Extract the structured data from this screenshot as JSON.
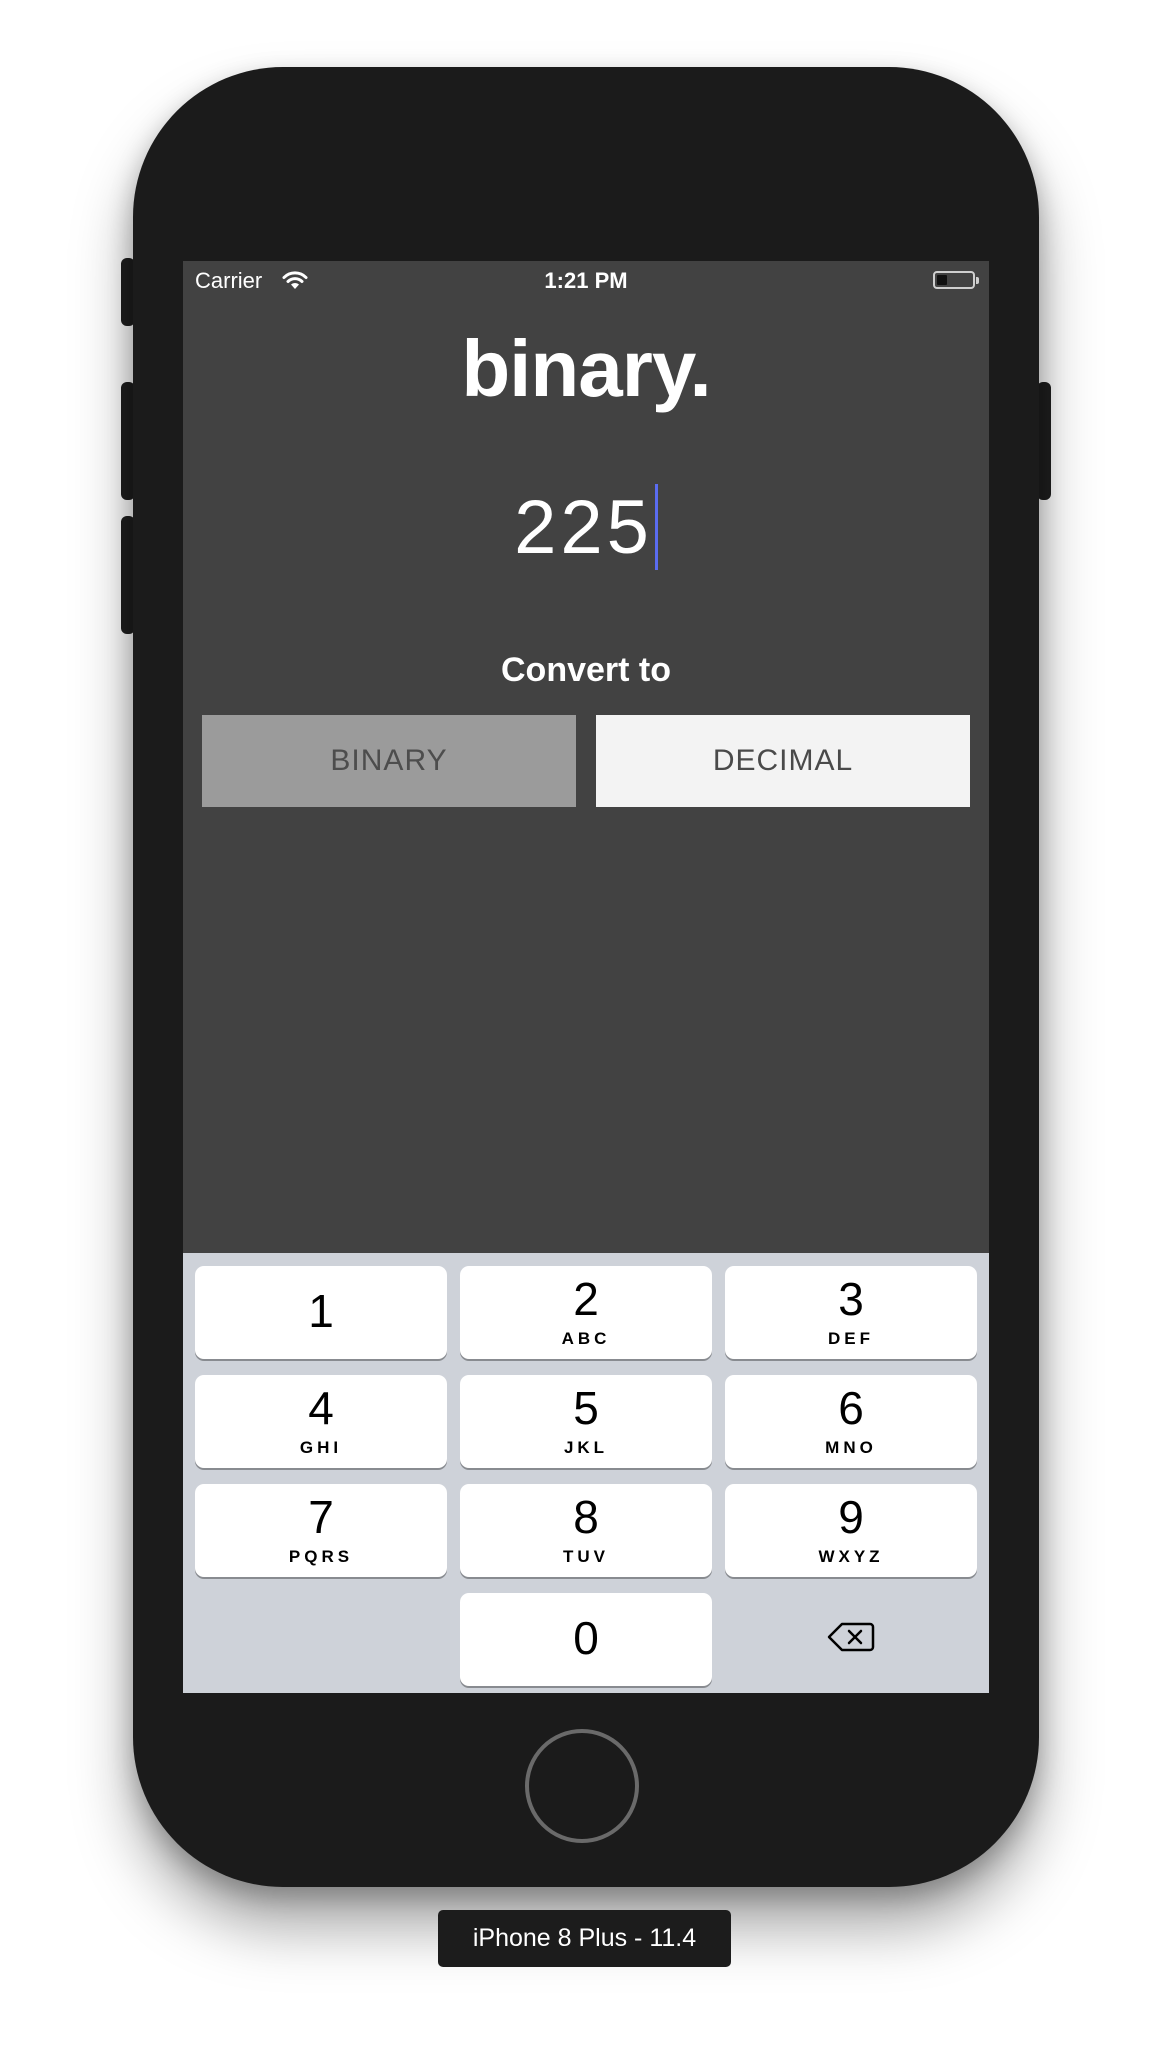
{
  "status_bar": {
    "carrier": "Carrier",
    "time": "1:21 PM"
  },
  "app": {
    "title": "binary.",
    "input_value": "225",
    "convert_label": "Convert to",
    "buttons": {
      "binary": "BINARY",
      "decimal": "DECIMAL"
    }
  },
  "keypad": {
    "keys": [
      {
        "digit": "1",
        "letters": ""
      },
      {
        "digit": "2",
        "letters": "ABC"
      },
      {
        "digit": "3",
        "letters": "DEF"
      },
      {
        "digit": "4",
        "letters": "GHI"
      },
      {
        "digit": "5",
        "letters": "JKL"
      },
      {
        "digit": "6",
        "letters": "MNO"
      },
      {
        "digit": "7",
        "letters": "PQRS"
      },
      {
        "digit": "8",
        "letters": "TUV"
      },
      {
        "digit": "9",
        "letters": "WXYZ"
      },
      {
        "digit": "0",
        "letters": ""
      }
    ],
    "delete_icon": "backspace-icon"
  },
  "simulator": {
    "device_label": "iPhone 8 Plus - 11.4"
  },
  "colors": {
    "screen_bg": "#424242",
    "selected_segment": "#9b9b9b",
    "unselected_segment": "#f3f3f3",
    "cursor": "#5a6cf0",
    "keyboard_bg": "#ced2d9"
  }
}
